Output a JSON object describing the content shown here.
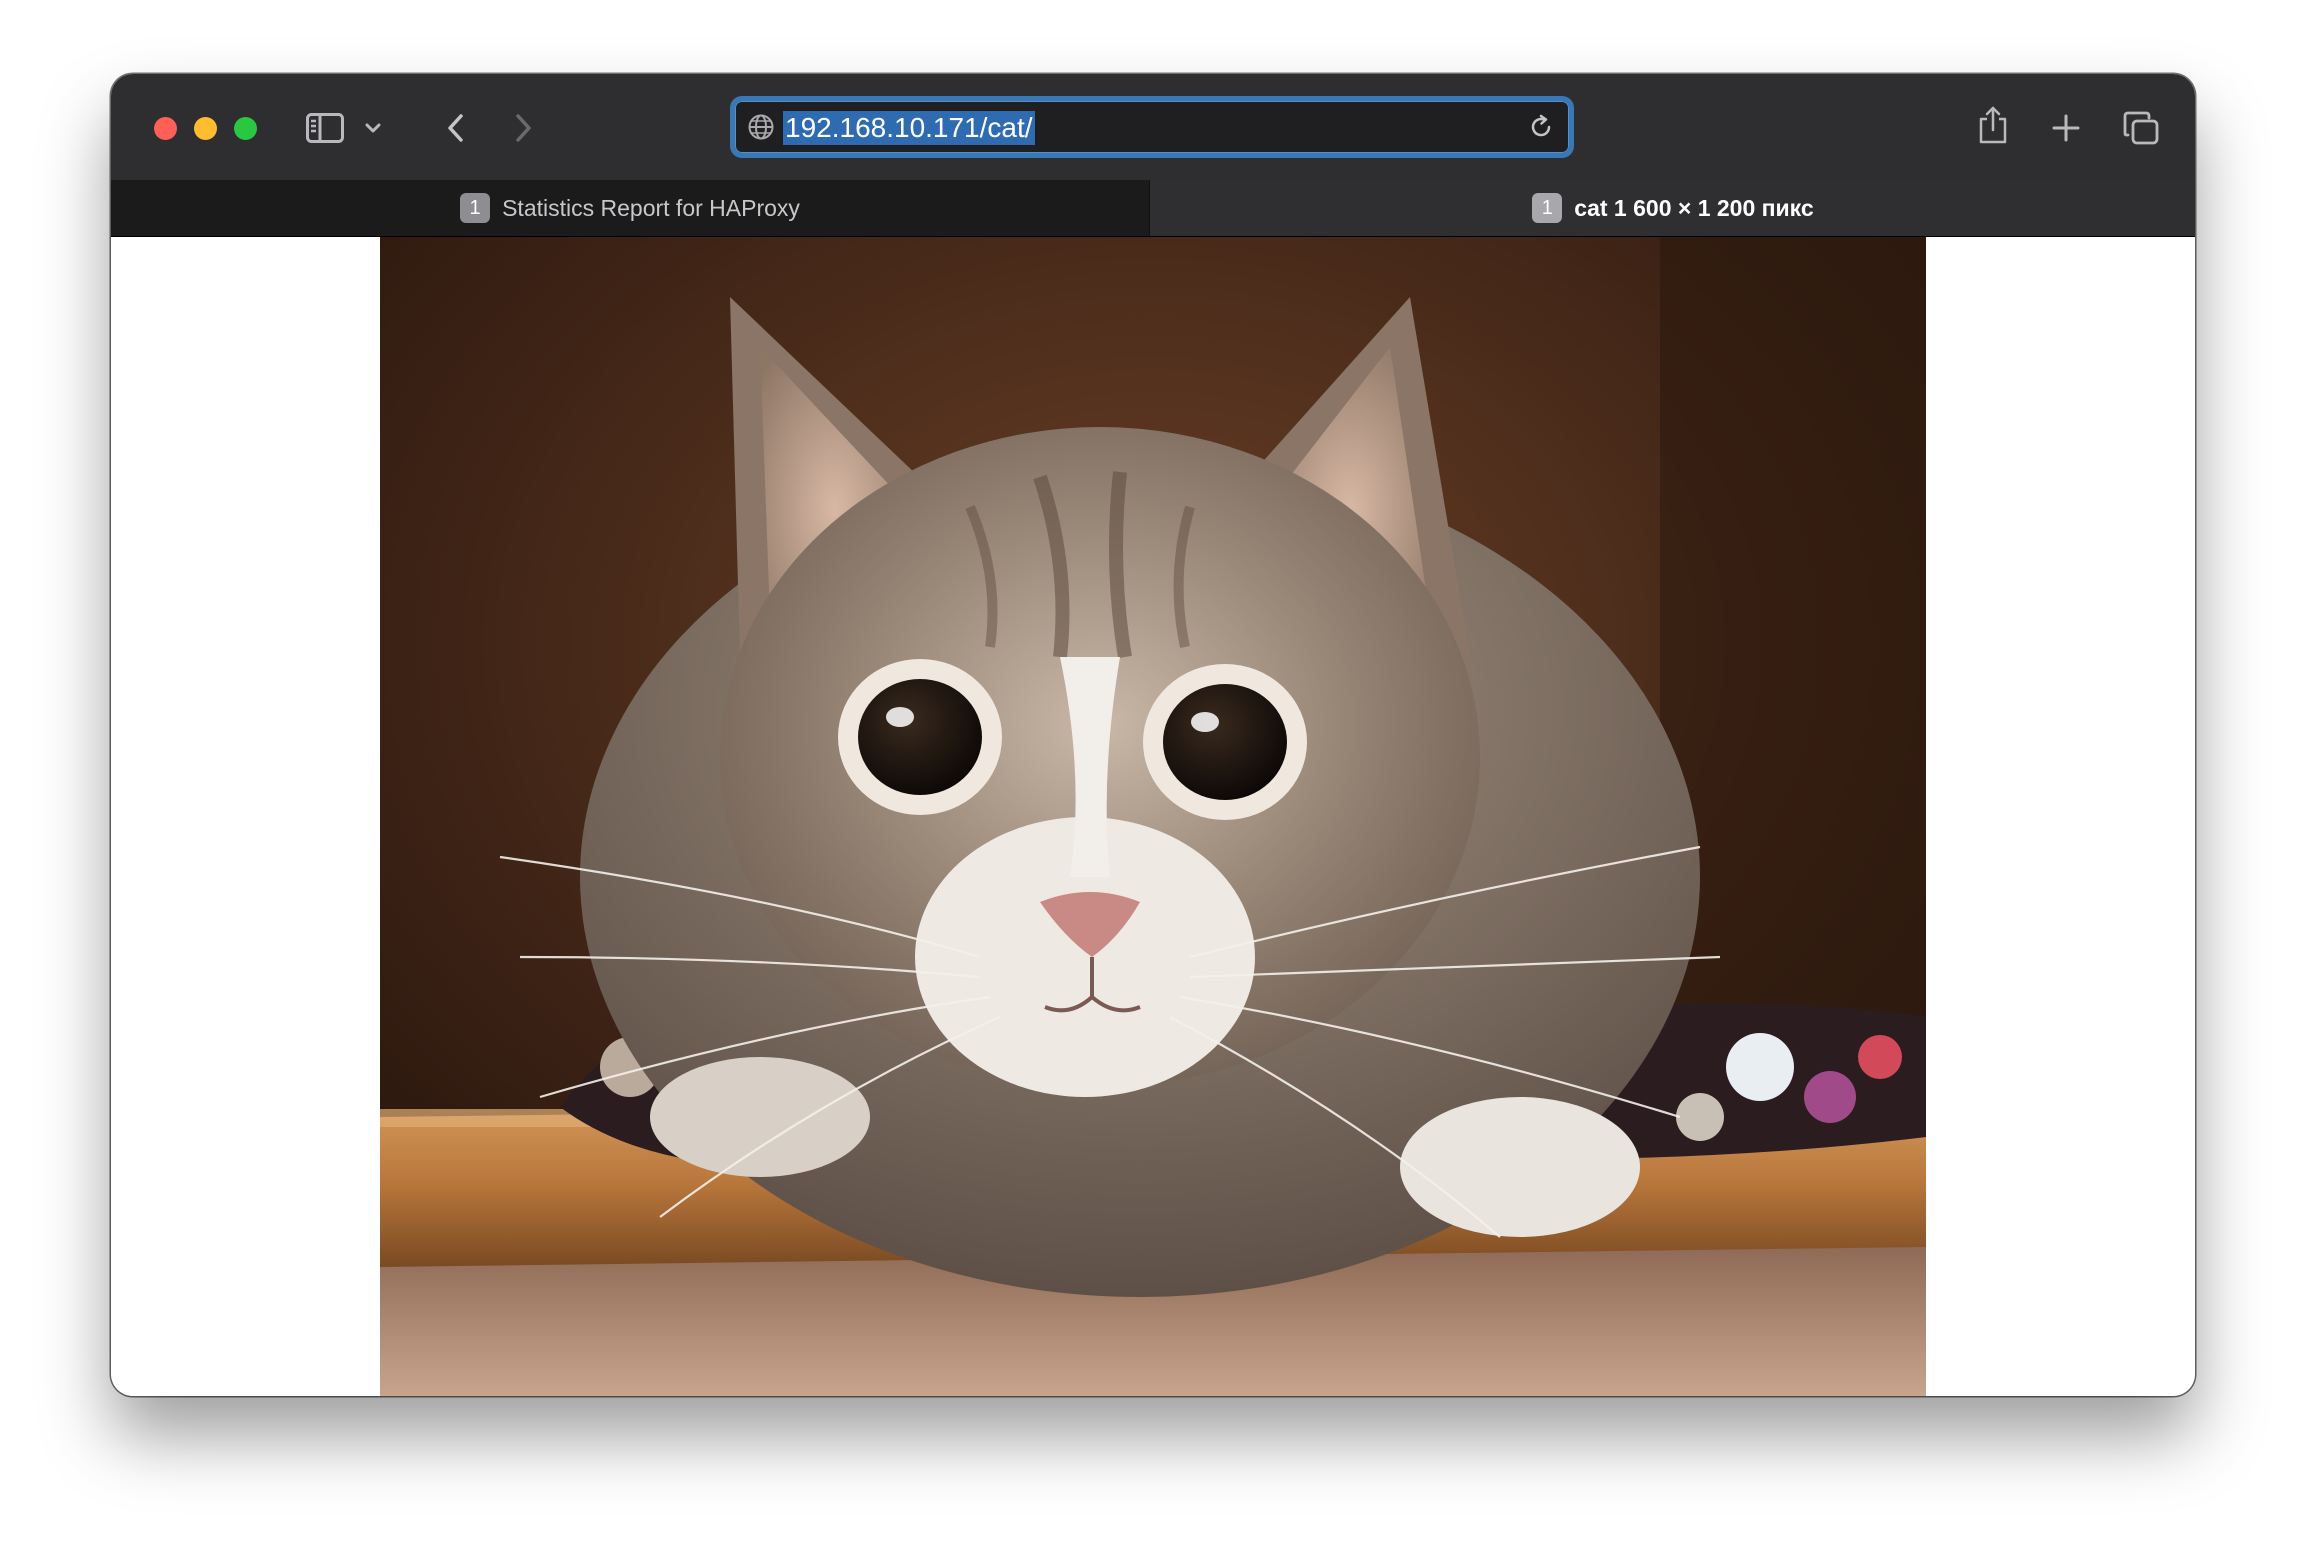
{
  "window": {
    "traffic_lights": {
      "close_color": "#ff5f57",
      "minimize_color": "#febc2e",
      "zoom_color": "#28c840"
    }
  },
  "toolbar": {
    "sidebar_icon": "sidebar-icon",
    "sidebar_menu_icon": "chevron-down-icon",
    "back_icon": "chevron-left-icon",
    "forward_icon": "chevron-right-icon",
    "share_icon": "share-icon",
    "new_tab_icon": "plus-icon",
    "tab_overview_icon": "tab-overview-icon"
  },
  "address_bar": {
    "site_icon": "globe-icon",
    "url": "192.168.10.171/cat/",
    "reload_icon": "reload-icon",
    "accent_color": "#3a78b5"
  },
  "tabs": [
    {
      "badge": "1",
      "title": "Statistics Report for HAProxy",
      "active": false
    },
    {
      "badge": "1",
      "title": "cat 1 600 × 1 200 пикс",
      "active": true
    }
  ],
  "content": {
    "image": "cat-photo"
  }
}
